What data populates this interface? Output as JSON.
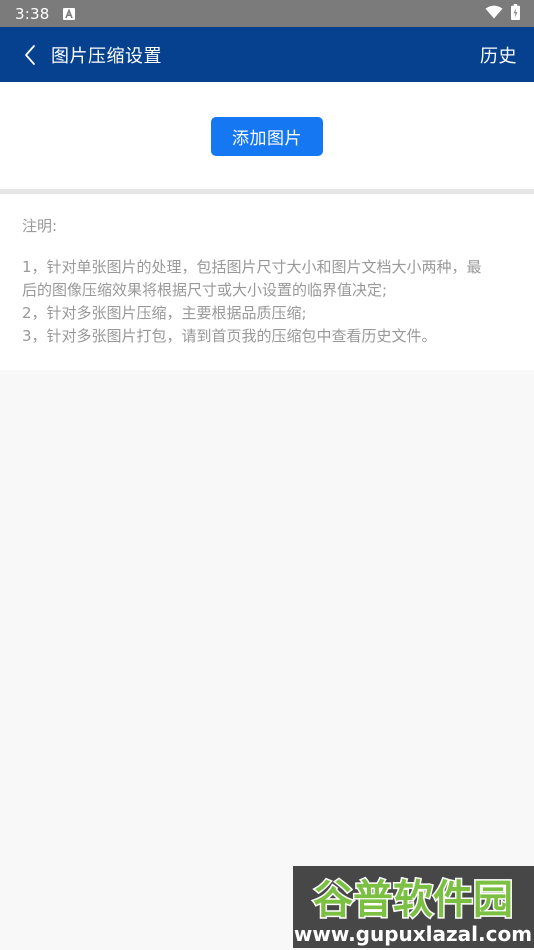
{
  "status_bar": {
    "time": "3:38",
    "icons": [
      "a-notification-icon",
      "wifi-icon",
      "battery-charging-icon"
    ]
  },
  "app_bar": {
    "title": "图片压缩设置",
    "history_label": "历史",
    "background": "#06418f"
  },
  "add_section": {
    "add_button_label": "添加图片",
    "button_color": "#1677f2"
  },
  "notes": {
    "title": "注明:",
    "lines": [
      "1，针对单张图片的处理，包括图片尺寸大小和图片文档大小两种，最",
      "后的图像压缩效果将根据尺寸或大小设置的临界值决定;",
      "2，针对多张图片压缩，主要根据品质压缩;",
      "3，针对多张图片打包，请到首页我的压缩包中查看历史文件。"
    ]
  },
  "watermark": {
    "title": "谷普软件园",
    "url": "www.gupuxlazal.com"
  }
}
